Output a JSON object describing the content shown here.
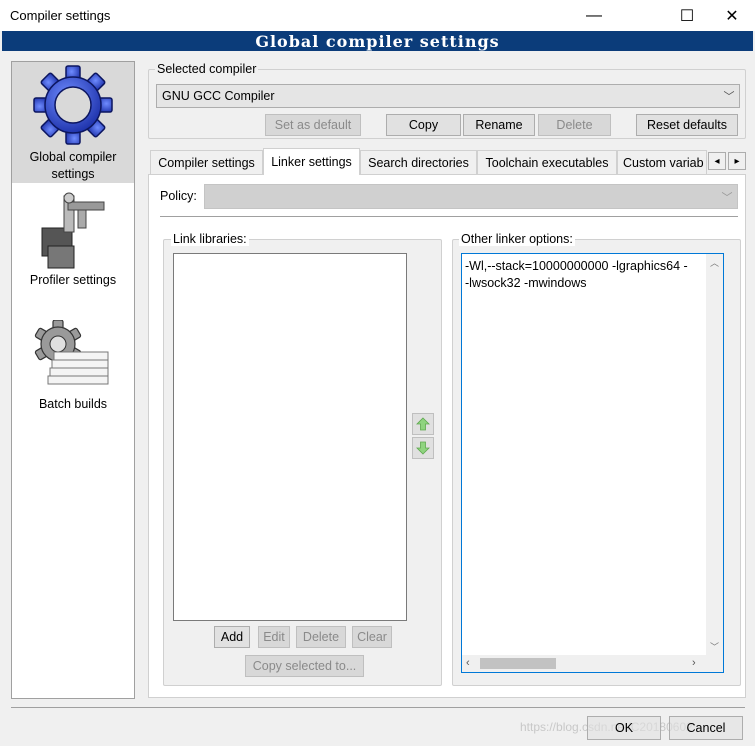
{
  "window": {
    "title": "Compiler settings",
    "min_glyph": "—",
    "max_glyph": "☐",
    "close_glyph": "✕",
    "banner": "Global compiler settings"
  },
  "sidebar": {
    "items": [
      {
        "label": "Global compiler settings",
        "icon": "gear-icon",
        "selected": true
      },
      {
        "label": "Profiler settings",
        "icon": "profiler-icon",
        "selected": false
      },
      {
        "label": "Batch builds",
        "icon": "batch-builds-icon",
        "selected": false
      }
    ]
  },
  "compiler": {
    "group_label": "Selected compiler",
    "selected": "GNU GCC Compiler",
    "buttons": {
      "set_default": "Set as default",
      "copy": "Copy",
      "rename": "Rename",
      "delete": "Delete",
      "reset": "Reset defaults"
    }
  },
  "tabs": [
    {
      "label": "Compiler settings"
    },
    {
      "label": "Linker settings"
    },
    {
      "label": "Search directories"
    },
    {
      "label": "Toolchain executables"
    },
    {
      "label": "Custom variab"
    }
  ],
  "tab_scroll": {
    "left": "◂",
    "right": "▸"
  },
  "linker": {
    "policy_label": "Policy:",
    "policy_value": "",
    "link_libraries_label": "Link libraries:",
    "other_options_label": "Other linker options:",
    "other_options_lines": [
      "-Wl,--stack=10000000000 -lgraphics64  -",
      "-lwsock32 -mwindows"
    ],
    "lib_buttons": {
      "add": "Add",
      "edit": "Edit",
      "delete": "Delete",
      "clear": "Clear",
      "copy_to": "Copy selected to..."
    }
  },
  "footer": {
    "ok": "OK",
    "cancel": "Cancel",
    "watermark": "https://blog.csdn.net/C20180602"
  },
  "colors": {
    "banner": "#0b3c7a",
    "focus": "#0078d7",
    "arrow_green": "#7fcf6f"
  }
}
